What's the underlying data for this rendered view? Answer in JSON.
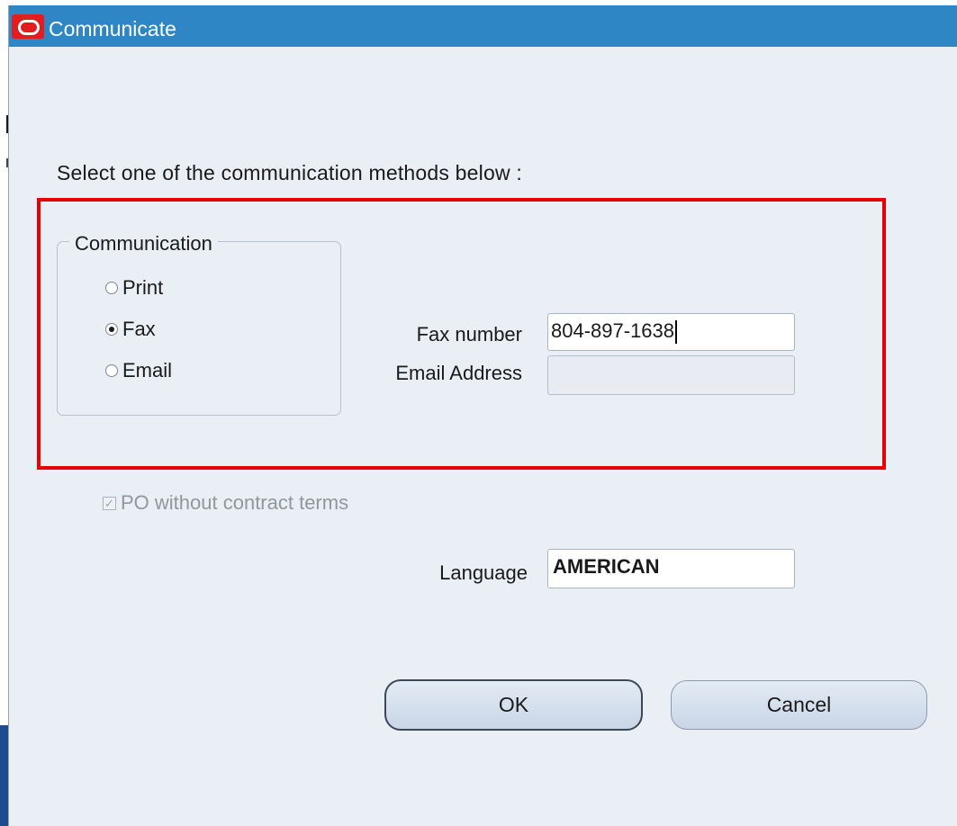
{
  "window": {
    "title": "Communicate"
  },
  "instruction": "Select one of the communication methods below :",
  "communication": {
    "legend": "Communication",
    "options": [
      {
        "label": "Print",
        "selected": false
      },
      {
        "label": "Fax",
        "selected": true
      },
      {
        "label": "Email",
        "selected": false
      }
    ]
  },
  "fax": {
    "label": "Fax number",
    "value": "804-897-1638"
  },
  "email": {
    "label": "Email Address",
    "value": ""
  },
  "contract": {
    "label": "PO without contract terms",
    "checked": true,
    "enabled": false
  },
  "language": {
    "label": "Language",
    "value": "AMERICAN"
  },
  "buttons": {
    "ok": "OK",
    "cancel": "Cancel"
  },
  "colors": {
    "titlebar": "#2f86c5",
    "highlight": "#e60000",
    "background": "#eaeef5"
  },
  "icons": {
    "title_logo": "oracle-logo-icon",
    "selected_marker": "radio-dot-icon",
    "check_marker": "checkmark-icon"
  }
}
